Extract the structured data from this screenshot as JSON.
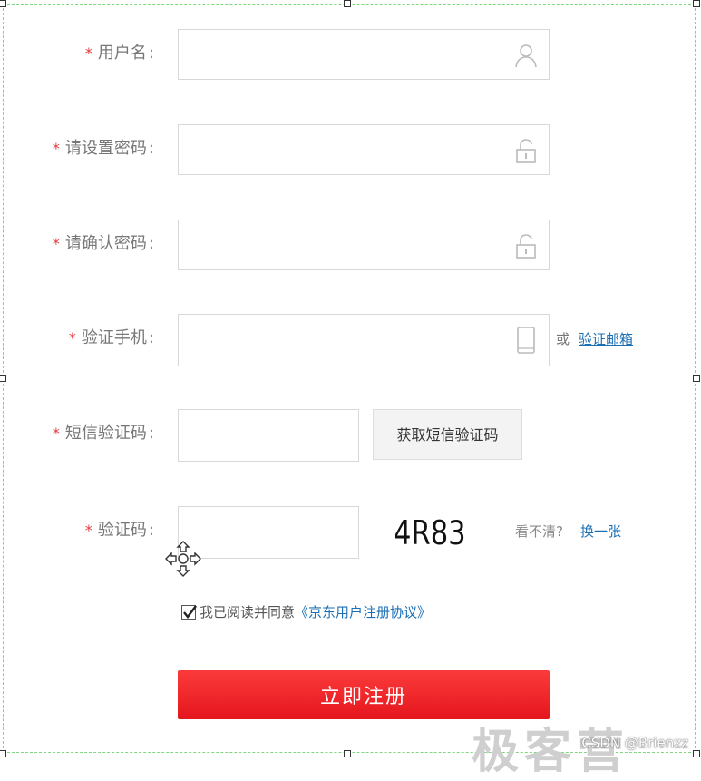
{
  "form": {
    "required_mark": "*",
    "username": {
      "label": "用户名",
      "icon": "user-icon",
      "value": ""
    },
    "password": {
      "label": "请设置密码",
      "icon": "lock-icon",
      "value": ""
    },
    "confirm_password": {
      "label": "请确认密码",
      "icon": "lock-icon",
      "value": ""
    },
    "phone": {
      "label": "验证手机",
      "icon": "phone-icon",
      "value": "",
      "or_text": "或",
      "email_link": "验证邮箱"
    },
    "sms_code": {
      "label": "短信验证码",
      "value": "",
      "button": "获取短信验证码"
    },
    "captcha": {
      "label": "验证码",
      "value": "",
      "image_text": "4R83",
      "unclear_text": "看不清?",
      "refresh_link": "换一张"
    },
    "agreement": {
      "checked": true,
      "text": "我已阅读并同意",
      "link": "《京东用户注册协议》"
    },
    "submit": "立即注册"
  },
  "watermark": {
    "csdn": "CSDN @Brienzz",
    "brand": "极客营"
  },
  "colors": {
    "required": "#e4393c",
    "link": "#1c6fb5",
    "submit_bg": "#e4161d",
    "frame_border": "#7fd67f"
  }
}
